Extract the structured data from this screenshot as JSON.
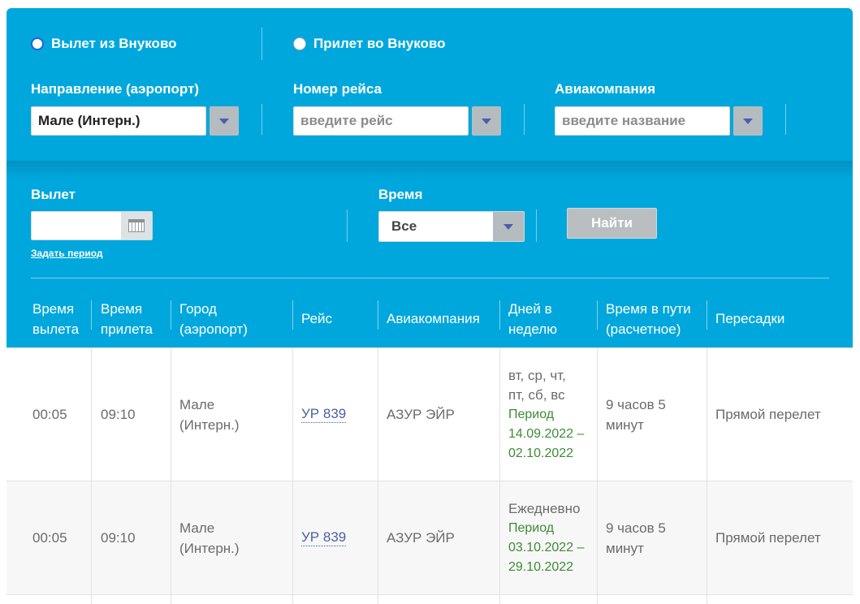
{
  "direction": {
    "departure_label": "Вылет из Внуково",
    "arrival_label": "Прилет во Внуково"
  },
  "filters": {
    "destination_label": "Направление (аэропорт)",
    "destination_value": "Мале (Интерн.)",
    "flight_label": "Номер рейса",
    "flight_placeholder": "введите рейс",
    "airline_label": "Авиакомпания",
    "airline_placeholder": "введите название",
    "departure_date_label": "Вылет",
    "set_period_link": "Задать период",
    "time_label": "Время",
    "time_value": "Все",
    "find_button": "Найти"
  },
  "table": {
    "headers": {
      "departure_time": [
        "Время",
        "вылета"
      ],
      "arrival_time": [
        "Время",
        "прилета"
      ],
      "city": [
        "Город",
        "(аэропорт)"
      ],
      "flight": "Рейс",
      "airline": "Авиакомпания",
      "days": [
        "Дней в",
        "неделю"
      ],
      "duration": [
        "Время в пути",
        "(расчетное)"
      ],
      "transfers": "Пересадки"
    },
    "rows": [
      {
        "departure": "00:05",
        "arrival": "09:10",
        "city": [
          "Мале",
          "(Интерн.)"
        ],
        "flight": "УР 839",
        "airline": "АЗУР ЭЙР",
        "days": [
          "вт, ср, чт,",
          "пт, сб, вс"
        ],
        "period": [
          "Период",
          "14.09.2022 –",
          "02.10.2022"
        ],
        "duration": [
          "9 часов 5",
          "минут"
        ],
        "transfers": "Прямой перелет"
      },
      {
        "departure": "00:05",
        "arrival": "09:10",
        "city": [
          "Мале",
          "(Интерн.)"
        ],
        "flight": "УР 839",
        "airline": "АЗУР ЭЙР",
        "days": [
          "Ежедневно"
        ],
        "period": [
          "Период",
          "03.10.2022 –",
          "29.10.2022"
        ],
        "duration": [
          "9 часов 5",
          "минут"
        ],
        "transfers": "Прямой перелет"
      }
    ]
  },
  "colors": {
    "header_bg": "#00a7dc",
    "link": "#4a5fa8",
    "period_text": "#3f8a36",
    "alt_row_bg": "#f7f7f7"
  }
}
